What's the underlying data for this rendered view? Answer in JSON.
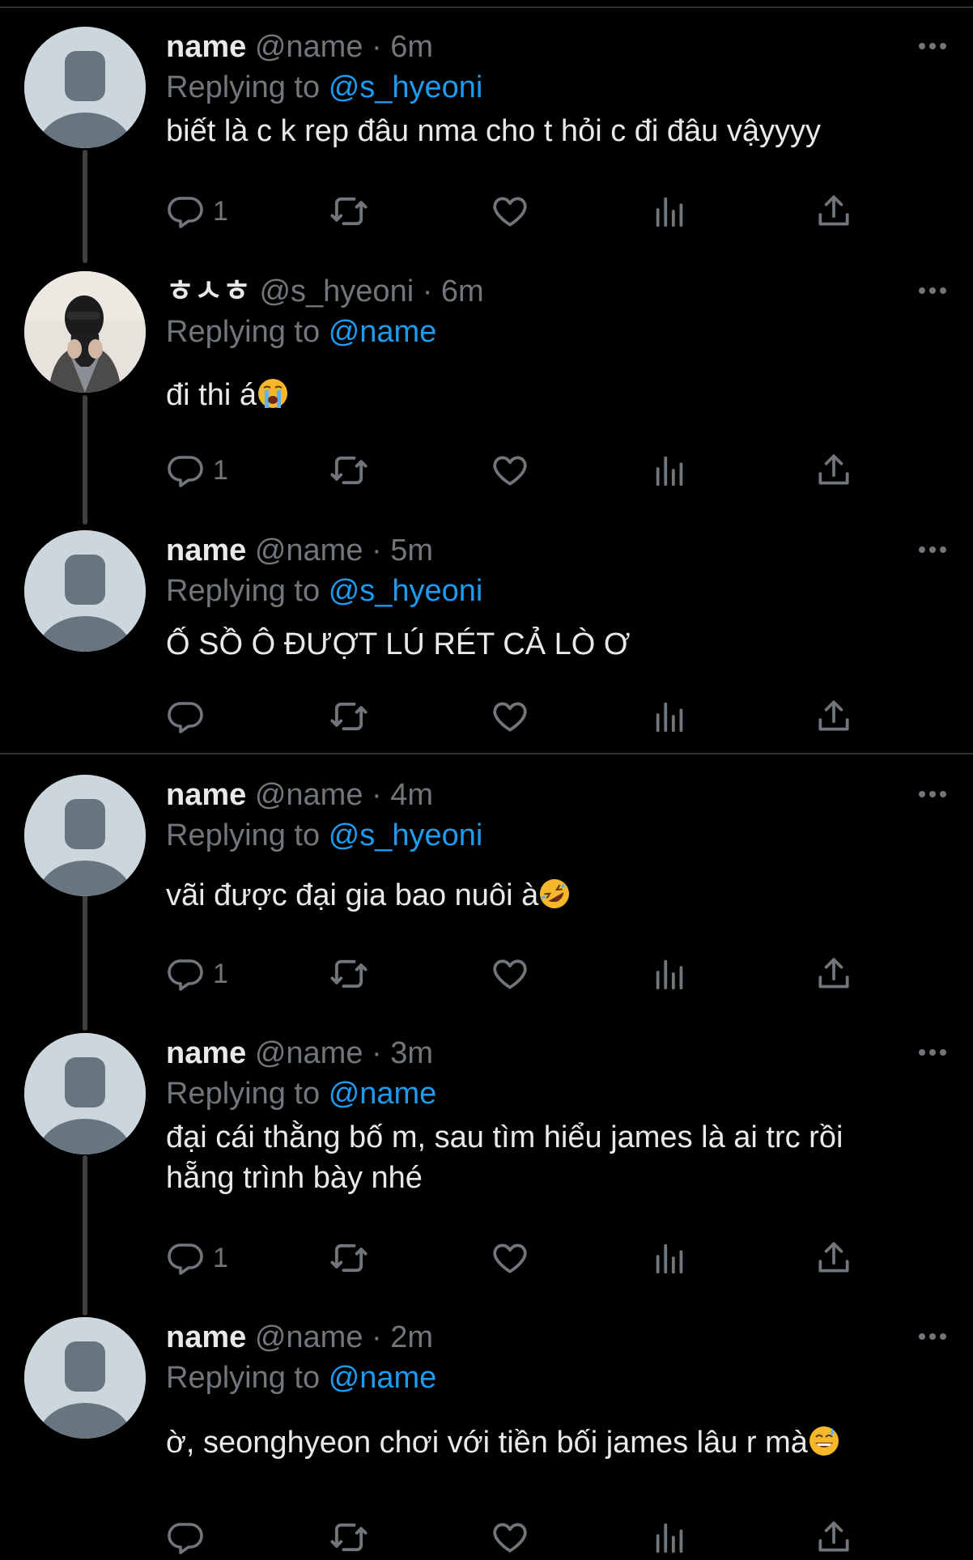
{
  "colors": {
    "background": "#000000",
    "text": "#e7e9ea",
    "muted": "#71767b",
    "mention": "#1d9bf0",
    "divider": "#2f3336",
    "thread_line": "#3e4144"
  },
  "labels": {
    "replying_to": "Replying to",
    "dot": "·"
  },
  "tweets": [
    {
      "name": "name",
      "handle": "@name",
      "time": "6m",
      "reply_to": "@s_hyeoni",
      "text": "biết là c k rep đâu nma cho t hỏi c đi đâu vậyyyy",
      "text_line2": "",
      "emoji": "",
      "reply_count": "1",
      "avatar": "default-avatar"
    },
    {
      "name": "ㅎㅅㅎ",
      "handle": "@s_hyeoni",
      "time": "6m",
      "reply_to": "@name",
      "text": "đi thi á",
      "text_line2": "",
      "emoji": "loudly-crying-face",
      "reply_count": "1",
      "avatar": "photo-avatar"
    },
    {
      "name": "name",
      "handle": "@name",
      "time": "5m",
      "reply_to": "@s_hyeoni",
      "text": "Ố SỒ Ô ĐƯỢT LÚ RÉT CẢ LÒ Ơ",
      "text_line2": "",
      "emoji": "",
      "reply_count": "",
      "avatar": "default-avatar"
    },
    {
      "name": "name",
      "handle": "@name",
      "time": "4m",
      "reply_to": "@s_hyeoni",
      "text": "vãi được đại gia bao nuôi à",
      "text_line2": "",
      "emoji": "rolling-on-floor-laughing",
      "reply_count": "1",
      "avatar": "default-avatar"
    },
    {
      "name": "name",
      "handle": "@name",
      "time": "3m",
      "reply_to": "@name",
      "text": "đại cái thằng bố m, sau tìm hiểu james là ai trc rồi",
      "text_line2": "hẵng trình bày nhé",
      "emoji": "",
      "reply_count": "1",
      "avatar": "default-avatar"
    },
    {
      "name": "name",
      "handle": "@name",
      "time": "2m",
      "reply_to": "@name",
      "text": "ờ, seonghyeon chơi với tiền bối james lâu r mà",
      "text_line2": "",
      "emoji": "grinning-face-with-sweat",
      "reply_count": "",
      "avatar": "default-avatar"
    }
  ]
}
